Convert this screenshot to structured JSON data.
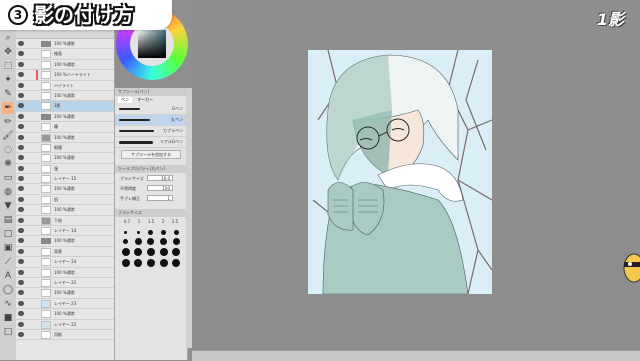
{
  "title": {
    "number": "3",
    "text": "影の付け方"
  },
  "overlay_badge": "1影",
  "layers": [
    {
      "label": "100 %通常",
      "type": "folder"
    },
    {
      "label": "線画",
      "type": "layer"
    },
    {
      "label": "100 %通常",
      "type": "layer"
    },
    {
      "label": "100 %ハードライト",
      "type": "layer",
      "mark": true
    },
    {
      "label": "ハイライト",
      "type": "layer"
    },
    {
      "label": "100 %通常",
      "type": "layer"
    },
    {
      "label": "1影",
      "type": "layer",
      "selected": true
    },
    {
      "label": "100 %通常",
      "type": "folder"
    },
    {
      "label": "瞳",
      "type": "layer"
    },
    {
      "label": "100 %通常",
      "type": "layer",
      "thumb": "gray"
    },
    {
      "label": "眼鏡",
      "type": "layer"
    },
    {
      "label": "100 %通常",
      "type": "layer"
    },
    {
      "label": "服",
      "type": "layer"
    },
    {
      "label": "レイヤー 15",
      "type": "layer"
    },
    {
      "label": "100 %通常",
      "type": "layer"
    },
    {
      "label": "肌",
      "type": "layer"
    },
    {
      "label": "100 %通常",
      "type": "layer"
    },
    {
      "label": "下絵",
      "type": "layer",
      "thumb": "gray"
    },
    {
      "label": "レイヤー 14",
      "type": "layer"
    },
    {
      "label": "100 %通常",
      "type": "folder"
    },
    {
      "label": "背景",
      "type": "layer"
    },
    {
      "label": "レイヤー 24",
      "type": "layer"
    },
    {
      "label": "100 %通常",
      "type": "layer"
    },
    {
      "label": "レイヤー 21",
      "type": "layer"
    },
    {
      "label": "100 %通常",
      "type": "layer"
    },
    {
      "label": "レイヤー 23",
      "type": "layer",
      "thumb": "blue"
    },
    {
      "label": "100 %通常",
      "type": "layer"
    },
    {
      "label": "レイヤー 22",
      "type": "layer",
      "thumb": "blue"
    },
    {
      "label": "用紙",
      "type": "layer"
    }
  ],
  "sub_tool_panel": {
    "title": "サブツール[ペン]",
    "tabs": [
      "ペン",
      "マーカー"
    ],
    "brushes": [
      {
        "label": "Gペン",
        "width": 30,
        "thick": 3
      },
      {
        "label": "丸ペン",
        "width": 44,
        "thick": 3,
        "selected": true
      },
      {
        "label": "カブラペン",
        "width": 50,
        "thick": 4
      },
      {
        "label": "リアルGペン",
        "width": 48,
        "thick": 5
      }
    ],
    "add_button": "サブツールを追加する"
  },
  "tool_property": {
    "title": "ツールプロパティ[丸ペン]",
    "rows": [
      {
        "label": "ブラシサイズ",
        "value": "10.0"
      },
      {
        "label": "不透明度",
        "value": "100"
      },
      {
        "label": "手ブレ補正",
        "value": "1"
      }
    ]
  },
  "brush_size": {
    "title": "ブラシサイズ",
    "values": [
      "0.7",
      "1",
      "1.5",
      "2",
      "2.5"
    ]
  },
  "colors": {
    "accent_selected": "#b8d2e8",
    "active_tool": "#f4b183",
    "canvas_bg": "#8e8e8e"
  }
}
